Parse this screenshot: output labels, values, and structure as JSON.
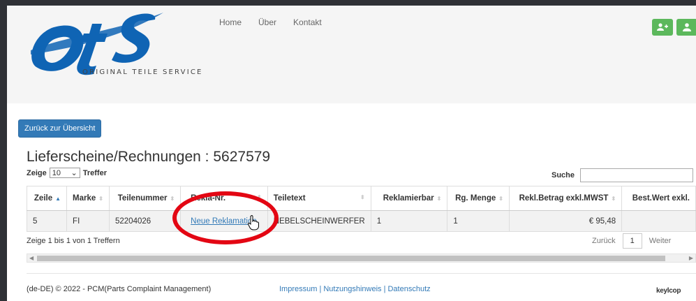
{
  "header": {
    "tagline": "ORIGINAL TEILE SERVICE",
    "nav": [
      "Home",
      "Über",
      "Kontakt"
    ],
    "buttons": [
      {
        "icon": "user-add-icon"
      },
      {
        "icon": "user-icon"
      }
    ],
    "colors": {
      "logo": "#0f64b4",
      "accent": "#5cb85c"
    }
  },
  "main": {
    "back_button": "Zurück zur Übersicht",
    "title": "Lieferscheine/Rechnungen : 5627579",
    "length_prefix": "Zeige",
    "length_value": "10",
    "length_suffix": "Treffer",
    "search_label": "Suche"
  },
  "table": {
    "columns": [
      "Zeile",
      "Marke",
      "Teilenummer",
      "Rekla-Nr.",
      "Teiletext",
      "Reklamierbar",
      "Rg. Menge",
      "Rekl.Betrag exkl.MWST",
      "Best.Wert exkl."
    ],
    "rows": [
      [
        "5",
        "FI",
        "52204026",
        "Neue Reklamation",
        "NEBELSCHEINWERFER",
        "1",
        "1",
        "€ 95,48",
        ""
      ]
    ]
  },
  "pagination": {
    "info": "Zeige 1 bis 1 von 1 Treffern",
    "prev": "Zurück",
    "page": "1",
    "next": "Weiter"
  },
  "footer": {
    "copyright": "(de-DE) © 2022 - PCM(Parts Complaint Management)",
    "links": "Impressum | Nutzungshinweis | Datenschutz",
    "brand": "keylcop"
  }
}
